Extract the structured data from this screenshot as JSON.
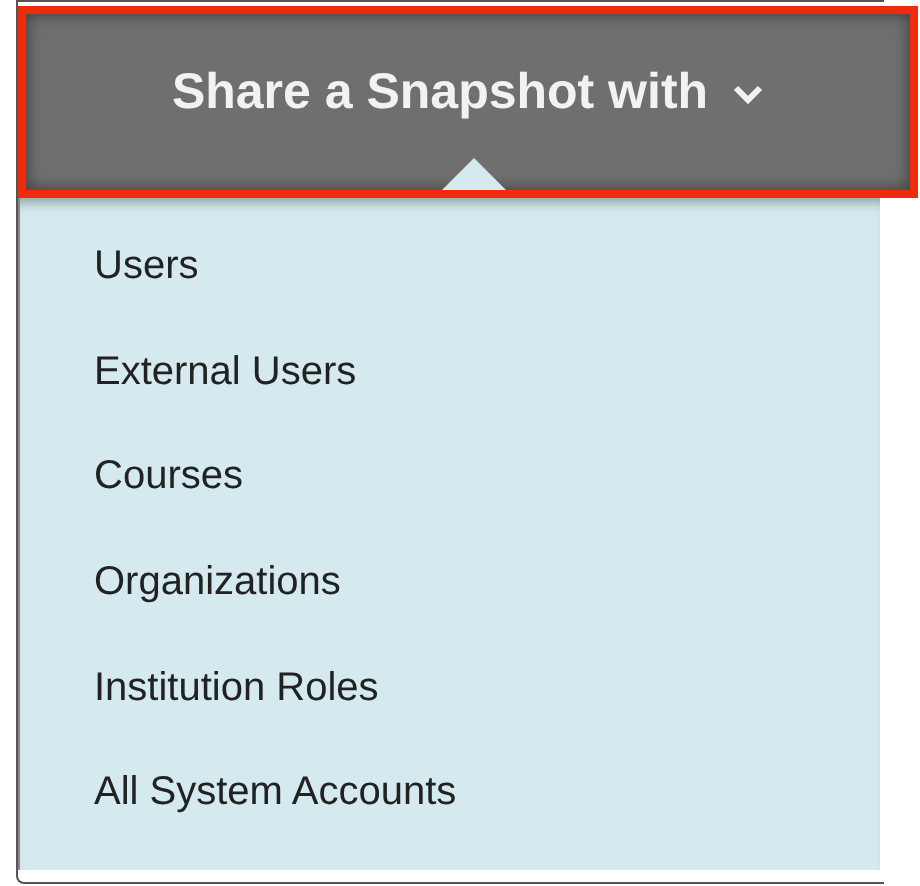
{
  "menu_button": {
    "label": "Share a Snapshot with",
    "highlighted": true
  },
  "menu_items": [
    {
      "label": "Users"
    },
    {
      "label": "External Users"
    },
    {
      "label": "Courses"
    },
    {
      "label": "Organizations"
    },
    {
      "label": "Institution Roles"
    },
    {
      "label": "All System Accounts"
    }
  ]
}
